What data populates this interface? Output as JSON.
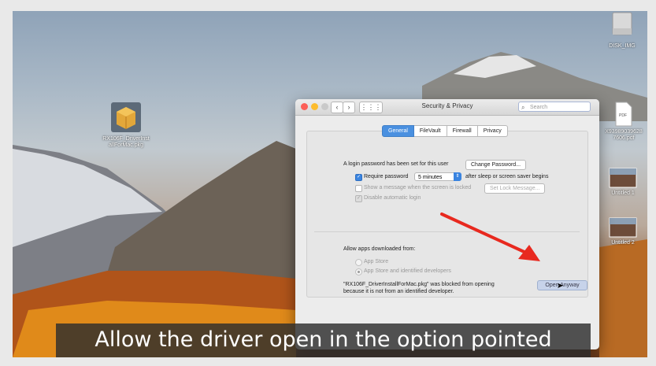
{
  "desktop": {
    "icons": [
      {
        "label": "RX106F_DriverInst allForMac.pkg"
      },
      {
        "label": "DISK_IMG"
      },
      {
        "label": "X93989039628 7606.pdf",
        "badge": "PDF"
      },
      {
        "label": "Untitled 1"
      },
      {
        "label": "Untitled 2"
      }
    ]
  },
  "window": {
    "title": "Security & Privacy",
    "search_placeholder": "Search",
    "tabs": [
      {
        "label": "General",
        "active": true
      },
      {
        "label": "FileVault",
        "active": false
      },
      {
        "label": "Firewall",
        "active": false
      },
      {
        "label": "Privacy",
        "active": false
      }
    ],
    "login_text": "A login password has been set for this user",
    "change_password_label": "Change Password...",
    "require_password_label": "Require password",
    "require_password_value": "5 minutes",
    "after_sleep_label": "after sleep or screen saver begins",
    "show_message_label": "Show a message when the screen is locked",
    "set_lock_message_label": "Set Lock Message...",
    "disable_login_label": "Disable automatic login",
    "allow_apps_label": "Allow apps downloaded from:",
    "radio_app_store": "App Store",
    "radio_identified": "App Store and identified developers",
    "blocked_line1": "\"RX106F_DriverInstallForMac.pkg\" was blocked from opening",
    "blocked_line2": "because it is not from an identified developer.",
    "open_anyway_label": "Open Anyway"
  },
  "caption": "Allow the driver open in the option pointed",
  "colors": {
    "arrow": "#e8291f",
    "accent": "#3a84e0"
  }
}
